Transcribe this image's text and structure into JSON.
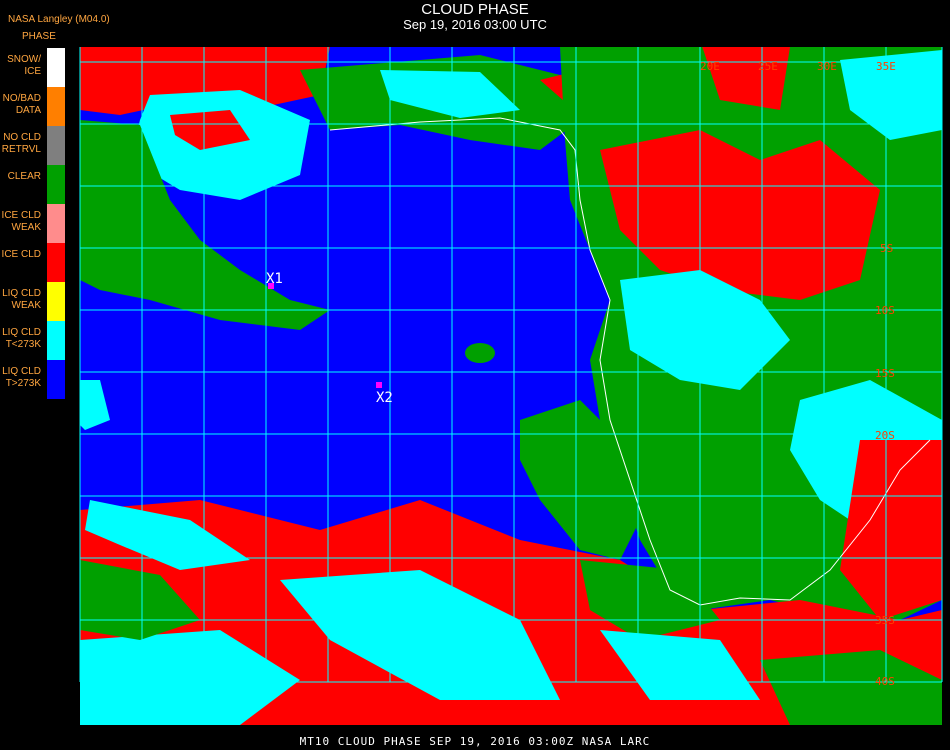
{
  "header": {
    "title": "CLOUD PHASE",
    "subtitle": "Sep 19, 2016 03:00 UTC",
    "source": "NASA Langley (M04.0)"
  },
  "legend": {
    "title": "PHASE",
    "items": [
      {
        "label": "SNOW/\nICE",
        "color": "#ffffff"
      },
      {
        "label": "NO/BAD\nDATA",
        "color": "#ff7f00"
      },
      {
        "label": "NO CLD\nRETRVL",
        "color": "#7f7f7f"
      },
      {
        "label": "CLEAR",
        "color": "#00a000"
      },
      {
        "label": "ICE CLD\nWEAK",
        "color": "#ff8c8c"
      },
      {
        "label": "ICE CLD",
        "color": "#ff0000"
      },
      {
        "label": "LIQ CLD\nWEAK",
        "color": "#ffff00"
      },
      {
        "label": "LIQ CLD\nT<273K",
        "color": "#00ffff"
      },
      {
        "label": "LIQ CLD\nT>273K",
        "color": "#0000ff"
      }
    ]
  },
  "map": {
    "lon_labels": [
      "20E",
      "25E",
      "30E",
      "35E"
    ],
    "lat_labels": [
      "5S",
      "10S",
      "15S",
      "20S",
      "35S",
      "40S"
    ],
    "markers": [
      {
        "label": "X1",
        "color": "#ff00ff"
      },
      {
        "label": "X2",
        "color": "#ff00ff"
      }
    ],
    "colors": {
      "ocean_liquid": "#0000ff",
      "land_clear": "#00a000",
      "ice_cloud": "#ff0000",
      "liquid_cold": "#00ffff",
      "grid": "#00ffff",
      "coast": "#ffffff",
      "grid_label": "#ff4000"
    }
  },
  "footer": {
    "text": "MT10  CLOUD PHASE   SEP 19, 2016 03:00Z   NASA LARC"
  }
}
